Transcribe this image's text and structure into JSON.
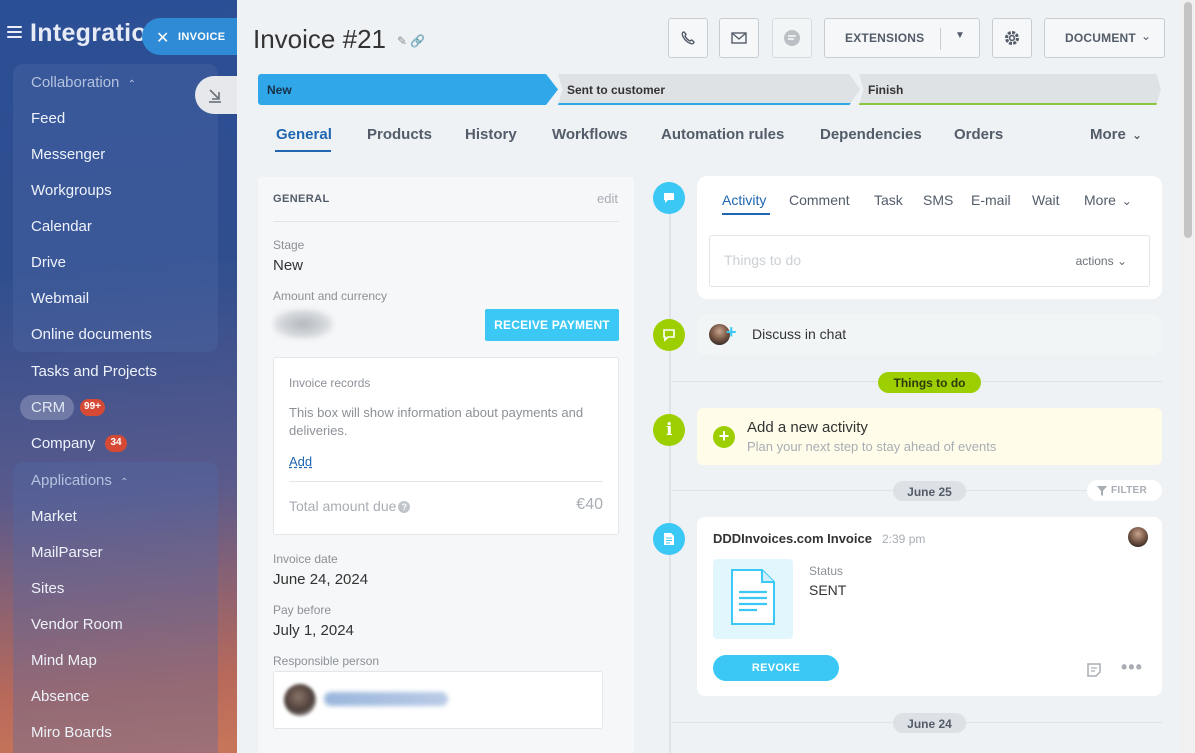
{
  "sidebar": {
    "title": "Integratio",
    "groups": {
      "collaboration": {
        "title": "Collaboration",
        "items": [
          "Feed",
          "Messenger",
          "Workgroups",
          "Calendar",
          "Drive",
          "Webmail",
          "Online documents"
        ]
      },
      "applications": {
        "title": "Applications",
        "items": [
          "Market",
          "MailParser",
          "Sites",
          "Vendor Room",
          "Mind Map",
          "Absence",
          "Miro Boards"
        ]
      }
    },
    "tasks_projects": "Tasks and Projects",
    "crm": {
      "label": "CRM",
      "badge": "99+"
    },
    "company": {
      "label": "Company",
      "badge": "34"
    }
  },
  "close_tab": {
    "label": "INVOICE"
  },
  "header": {
    "title": "Invoice #21",
    "extensions_label": "EXTENSIONS",
    "document_label": "DOCUMENT"
  },
  "stages": [
    "New",
    "Sent to customer",
    "Finish"
  ],
  "tabs": [
    "General",
    "Products",
    "History",
    "Workflows",
    "Automation rules",
    "Dependencies",
    "Orders"
  ],
  "tabs_more": "More",
  "general": {
    "heading": "GENERAL",
    "edit_label": "edit",
    "stage_label": "Stage",
    "stage_value": "New",
    "amount_label": "Amount and currency",
    "receive_payment_label": "RECEIVE PAYMENT",
    "records": {
      "title": "Invoice records",
      "text": "This box will show information about payments and deliveries.",
      "add_label": "Add",
      "total_label": "Total amount due",
      "total_value": "€40"
    },
    "invoice_date_label": "Invoice date",
    "invoice_date_value": "June 24, 2024",
    "pay_before_label": "Pay before",
    "pay_before_value": "July 1, 2024",
    "responsible_label": "Responsible person"
  },
  "activity": {
    "tabs": [
      "Activity",
      "Comment",
      "Task",
      "SMS",
      "E-mail",
      "Wait"
    ],
    "more_label": "More",
    "placeholder": "Things to do",
    "actions_label": "actions"
  },
  "chat": {
    "label": "Discuss in chat"
  },
  "things_to_do_pill": "Things to do",
  "todo": {
    "title": "Add a new activity",
    "subtitle": "Plan your next step to stay ahead of events"
  },
  "dates": {
    "first": "June 25",
    "second": "June 24"
  },
  "filter_label": "FILTER",
  "doc_event": {
    "title": "DDDInvoices.com Invoice",
    "time": "2:39 pm",
    "status_label": "Status",
    "status_value": "SENT",
    "revoke_label": "REVOKE"
  },
  "colors": {
    "accent_blue": "#2fa7e8",
    "button_cyan": "#3bc8f5",
    "green": "#9dcf00",
    "badge_red": "#d64a35"
  }
}
